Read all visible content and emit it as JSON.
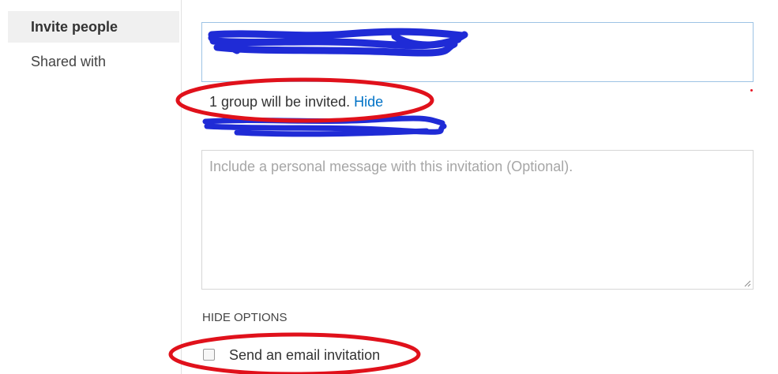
{
  "sidebar": {
    "items": [
      {
        "label": "Invite people",
        "selected": true
      },
      {
        "label": "Shared with",
        "selected": false
      }
    ]
  },
  "invite": {
    "status_text": "1 group will be invited.",
    "hide_link": "Hide"
  },
  "message": {
    "placeholder": "Include a personal message with this invitation (Optional).",
    "value": ""
  },
  "options": {
    "toggle_label": "HIDE OPTIONS",
    "send_email_label": "Send an email invitation",
    "send_email_checked": false
  },
  "colors": {
    "accent_link": "#0072c6",
    "picker_border": "#9dc3e4",
    "redaction": "#1f2bd6",
    "annotation_circle": "#e0111b"
  }
}
